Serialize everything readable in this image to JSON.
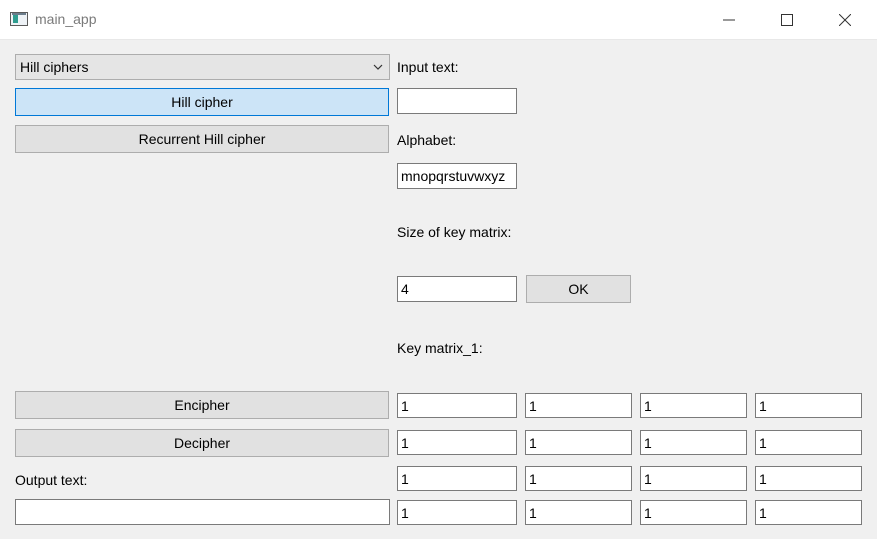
{
  "window": {
    "title": "main_app"
  },
  "controls": {
    "cipher_family": "Hill ciphers",
    "hill_cipher_button": "Hill cipher",
    "recurrent_hill_button": "Recurrent Hill cipher",
    "encipher_button": "Encipher",
    "decipher_button": "Decipher",
    "output_label": "Output text:",
    "output_value": ""
  },
  "form": {
    "input_label": "Input text:",
    "input_value": "",
    "alphabet_label": "Alphabet:",
    "alphabet_value": "mnopqrstuvwxyz",
    "size_label": "Size of key matrix:",
    "size_value": "4",
    "ok_button": "OK",
    "key_matrix_label": "Key matrix_1:"
  },
  "key_matrix": [
    [
      "1",
      "1",
      "1",
      "1"
    ],
    [
      "1",
      "1",
      "1",
      "1"
    ],
    [
      "1",
      "1",
      "1",
      "1"
    ],
    [
      "1",
      "1",
      "1",
      "1"
    ]
  ]
}
